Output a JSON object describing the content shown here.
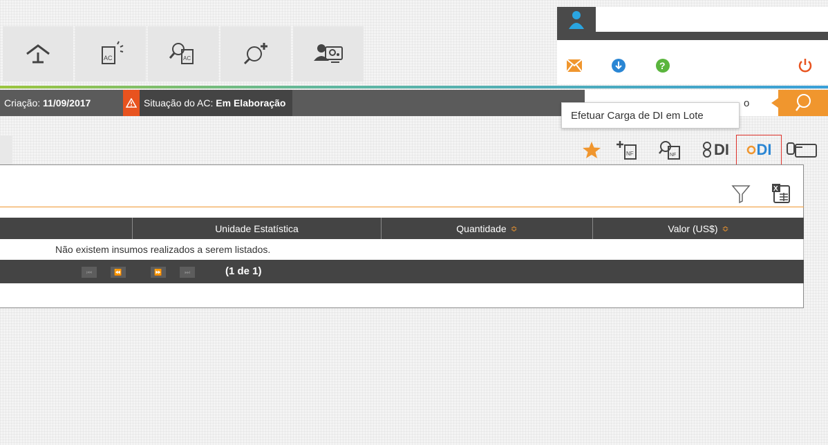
{
  "nav": {
    "items": [
      {
        "name": "home-upload-icon"
      },
      {
        "name": "ac-select-icon"
      },
      {
        "name": "ac-search-icon"
      },
      {
        "name": "search-add-icon"
      },
      {
        "name": "user-settings-icon"
      }
    ]
  },
  "user_panel": {
    "avatar_icon": "user-icon",
    "tools": [
      "mail-icon",
      "download-icon",
      "help-icon",
      "power-icon"
    ]
  },
  "status": {
    "creation_label": "Criação:",
    "creation_date": "11/09/2017",
    "situation_label": "Situação do AC:",
    "situation_value": "Em Elaboração"
  },
  "search": {
    "partial_text": "o"
  },
  "tooltip": {
    "text": "Efetuar Carga de DI em Lote"
  },
  "actions": {
    "di_label_1": "DI",
    "di_label_2": "DI"
  },
  "table": {
    "headers": {
      "unidade": "Unidade Estatística",
      "quantidade": "Quantidade",
      "valor": "Valor (US$)"
    },
    "sort_glyph": "≎",
    "empty_message": "Não existem insumos realizados a serem listados.",
    "pager": {
      "first": "⏮",
      "prev": "⏪",
      "next": "⏩",
      "last": "⏭",
      "info": "(1 de 1)"
    }
  },
  "colors": {
    "accent": "#f0962e",
    "dark": "#444444",
    "warning": "#e8531f",
    "blue": "#2a86d4",
    "green": "#5ab53d"
  }
}
